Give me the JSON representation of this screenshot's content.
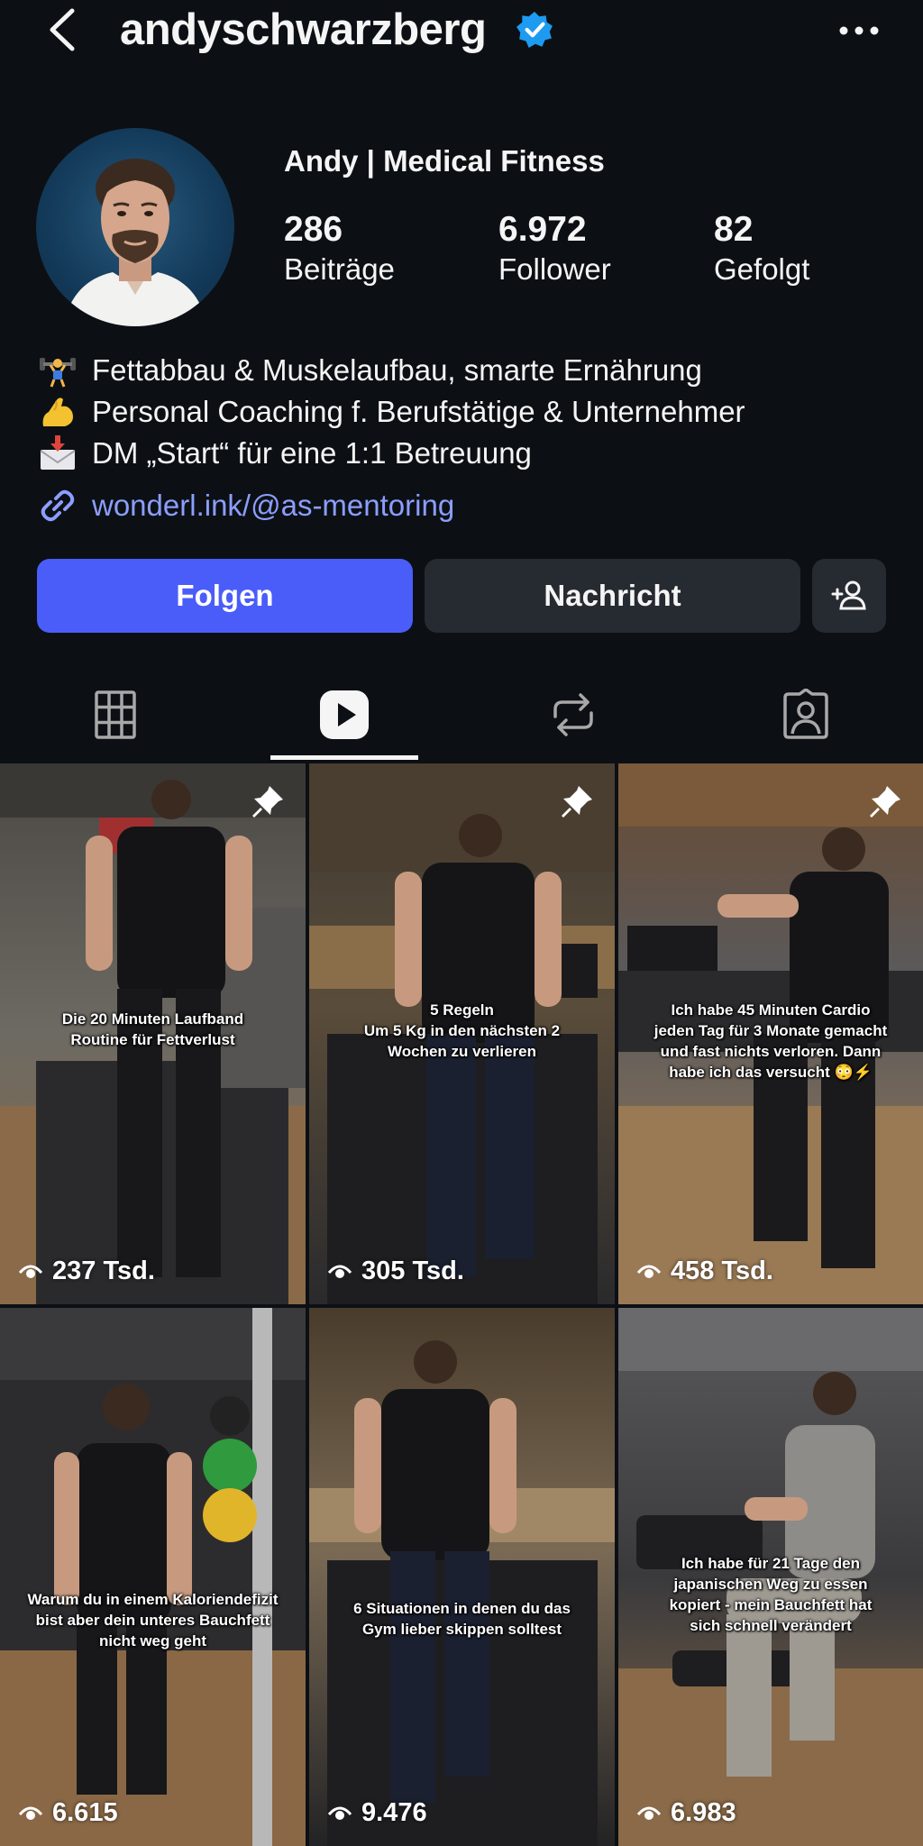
{
  "header": {
    "username": "andyschwarzberg",
    "verified_color": "#1d9bf0",
    "icons": {
      "back": "chevron-left-icon",
      "more": "more-horizontal-icon"
    }
  },
  "profile": {
    "display_name": "Andy | Medical Fitness",
    "stats": [
      {
        "value": "286",
        "label": "Beiträge"
      },
      {
        "value": "6.972",
        "label": "Follower"
      },
      {
        "value": "82",
        "label": "Gefolgt"
      }
    ],
    "bio": [
      {
        "emoji": "🏋",
        "text": "Fettabbau & Muskelaufbau, smarte Ernährung"
      },
      {
        "emoji": "💪",
        "text": "Personal Coaching f. Berufstätige & Unternehmer"
      },
      {
        "emoji": "📩",
        "text": "DM „Start“ für eine 1:1 Betreuung"
      }
    ],
    "link": "wonderl.ink/@as-mentoring",
    "link_color": "#8c9eff"
  },
  "actions": {
    "follow": "Folgen",
    "message": "Nachricht",
    "follow_color": "#4a5df9"
  },
  "tabs": [
    {
      "name": "tab-posts",
      "icon": "grid-icon",
      "active": false
    },
    {
      "name": "tab-reels",
      "icon": "reels-icon",
      "active": true
    },
    {
      "name": "tab-reposts",
      "icon": "repost-icon",
      "active": false
    },
    {
      "name": "tab-tagged",
      "icon": "tagged-icon",
      "active": false
    }
  ],
  "reels": [
    {
      "caption": "Die 20 Minuten Laufband\nRoutine für Fettverlust",
      "views": "237 Tsd.",
      "pinned": true
    },
    {
      "caption": "5 Regeln\nUm 5 Kg in den nächsten 2\nWochen zu verlieren",
      "views": "305 Tsd.",
      "pinned": true
    },
    {
      "caption": "Ich habe 45 Minuten Cardio\njeden Tag für 3 Monate gemacht\nund fast nichts verloren. Dann\nhabe ich das versucht 😳⚡",
      "views": "458 Tsd.",
      "pinned": true
    },
    {
      "caption": "Warum du in einem Kaloriendefizit\nbist aber dein unteres Bauchfett\nnicht weg geht",
      "views": "6.615",
      "pinned": false
    },
    {
      "caption": "6 Situationen in denen du das\nGym lieber skippen solltest",
      "views": "9.476",
      "pinned": false
    },
    {
      "caption": "Ich habe für 21 Tage den\njapanischen Weg zu essen\nkopiert - mein Bauchfett hat\nsich schnell verändert",
      "views": "6.983",
      "pinned": false
    }
  ]
}
